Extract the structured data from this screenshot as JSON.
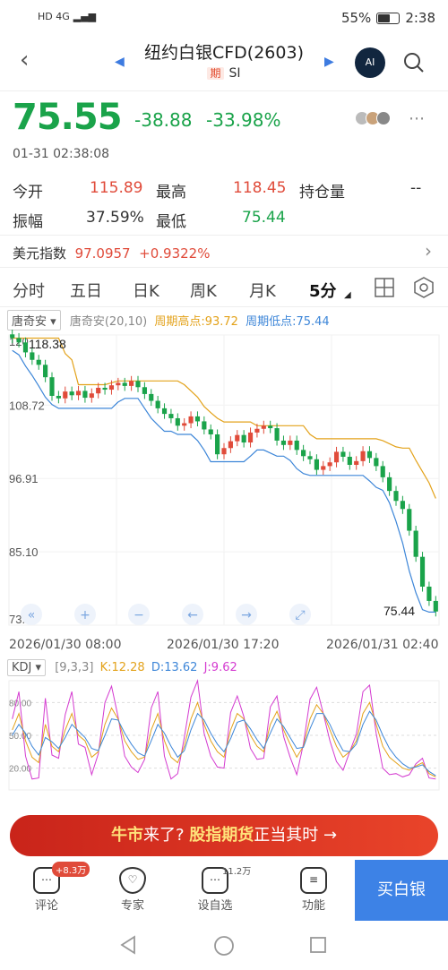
{
  "status": {
    "left": "HD 4G",
    "battery": "55%",
    "time": "2:38"
  },
  "header": {
    "title": "纽约白银CFD(2603)",
    "tag": "期",
    "code": "SI",
    "ai": "AI"
  },
  "quote": {
    "price": "75.55",
    "change": "-38.88",
    "pct": "-33.98%",
    "time": "01-31 02:38:08",
    "open_l": "今开",
    "open": "115.89",
    "high_l": "最高",
    "high": "118.45",
    "oi_l": "持仓量",
    "oi": "--",
    "amp_l": "振幅",
    "amp": "37.59%",
    "low_l": "最低",
    "low": "75.44",
    "usd_l": "美元指数",
    "usd": "97.0957",
    "usd_chg": "+0.9322%"
  },
  "tabs": [
    "分时",
    "五日",
    "日K",
    "周K",
    "月K",
    "5分"
  ],
  "indicator": {
    "name": "唐奇安",
    "params": "唐奇安(20,10)",
    "high": "周期高点:93.72",
    "low": "周期低点:75.44"
  },
  "yaxis": [
    "120",
    "108.72",
    "96.91",
    "85.10",
    "73.30"
  ],
  "hi_label": "118.38",
  "lo_label": "75.44",
  "xaxis": [
    "2026/01/30 08:00",
    "2026/01/30 17:20",
    "2026/01/31 02:40"
  ],
  "kdj": {
    "name": "KDJ",
    "params": "[9,3,3]",
    "k": "K:12.28",
    "d": "D:13.62",
    "j": "J:9.62",
    "levels": [
      "80.00",
      "50.00",
      "20.00"
    ]
  },
  "banner": {
    "a": "牛市",
    "b": "来了? ",
    "c": "股指期货",
    "d": "正当其时 →"
  },
  "bottom": {
    "comment": "评论",
    "comment_badge": "+8.3万",
    "expert": "专家",
    "watch": "设自选",
    "watch_count": "11.2万",
    "func": "功能",
    "buy": "买白银"
  },
  "colors": {
    "up": "#e04b3a",
    "down": "#1aa34a",
    "upper": "#e3a21a",
    "lower": "#3d86d8",
    "buy": "#3d82e6"
  },
  "chart_data": {
    "type": "candlestick",
    "ylim": [
      73.3,
      120
    ],
    "yticks": [
      120,
      108.72,
      96.91,
      85.1,
      73.3
    ],
    "close": [
      119.5,
      118.8,
      117.2,
      116.0,
      115.2,
      113.2,
      110.2,
      109.8,
      110.9,
      110.3,
      111.0,
      109.9,
      110.6,
      111.5,
      111.2,
      111.9,
      112.3,
      111.8,
      112.6,
      111.6,
      110.5,
      109.4,
      108.2,
      107.3,
      106.6,
      105.4,
      105.8,
      106.9,
      106.1,
      104.8,
      104.0,
      100.8,
      101.8,
      102.9,
      103.9,
      102.7,
      104.3,
      104.9,
      105.4,
      105.0,
      103.0,
      102.3,
      103.0,
      101.5,
      100.5,
      100.0,
      98.3,
      98.9,
      99.5,
      101.2,
      100.4,
      99.1,
      99.7,
      101.3,
      100.2,
      98.9,
      97.1,
      94.9,
      93.3,
      92.0,
      88.5,
      84.3,
      79.5,
      77.2,
      75.5
    ],
    "upper": [
      119.5,
      119.5,
      119.5,
      119.5,
      119.5,
      119.5,
      119.5,
      119.5,
      117.0,
      116.0,
      112.0,
      112.0,
      112.0,
      112.0,
      112.0,
      112.3,
      112.6,
      112.6,
      112.6,
      112.6,
      112.6,
      112.6,
      112.6,
      112.6,
      112.6,
      112.6,
      112.0,
      111.0,
      110.0,
      108.5,
      107.5,
      106.6,
      106.0,
      106.0,
      106.0,
      106.0,
      106.0,
      105.4,
      105.4,
      105.4,
      105.4,
      105.4,
      105.4,
      105.4,
      105.4,
      104.0,
      103.3,
      103.3,
      103.3,
      103.3,
      103.3,
      103.3,
      103.3,
      103.3,
      103.3,
      103.3,
      103.0,
      102.5,
      102.0,
      101.8,
      101.8,
      99.8,
      98.0,
      96.2,
      93.7
    ],
    "lower": [
      117.5,
      116.8,
      115.0,
      113.5,
      111.8,
      110.0,
      108.8,
      108.2,
      108.2,
      108.2,
      108.2,
      108.2,
      108.2,
      108.2,
      108.2,
      108.2,
      109.2,
      109.8,
      109.8,
      109.8,
      108.2,
      106.6,
      105.5,
      104.5,
      104.5,
      104.0,
      104.0,
      104.0,
      103.0,
      101.5,
      99.6,
      99.6,
      99.6,
      99.6,
      99.6,
      99.6,
      100.5,
      101.5,
      101.5,
      101.0,
      100.5,
      100.5,
      99.8,
      98.5,
      97.7,
      97.4,
      97.4,
      97.4,
      97.4,
      97.4,
      97.4,
      97.4,
      97.4,
      97.4,
      96.5,
      95.5,
      95.0,
      93.0,
      90.0,
      86.5,
      82.0,
      78.5,
      75.8,
      75.4,
      75.4
    ],
    "kdj_k": [
      55,
      70,
      45,
      30,
      25,
      60,
      40,
      35,
      55,
      70,
      50,
      45,
      30,
      35,
      60,
      75,
      65,
      45,
      35,
      28,
      30,
      55,
      70,
      45,
      30,
      25,
      40,
      65,
      80,
      60,
      45,
      35,
      30,
      55,
      70,
      65,
      50,
      40,
      35,
      60,
      72,
      55,
      42,
      30,
      40,
      65,
      78,
      70,
      55,
      40,
      30,
      35,
      45,
      70,
      80,
      60,
      40,
      30,
      25,
      20,
      18,
      22,
      25,
      15,
      12
    ],
    "kdj_d": [
      50,
      60,
      52,
      40,
      32,
      48,
      44,
      38,
      48,
      60,
      54,
      48,
      38,
      36,
      50,
      65,
      64,
      52,
      42,
      34,
      31,
      45,
      60,
      52,
      40,
      30,
      36,
      55,
      70,
      64,
      52,
      42,
      35,
      47,
      62,
      64,
      56,
      46,
      38,
      52,
      65,
      58,
      48,
      38,
      39,
      56,
      70,
      70,
      60,
      47,
      36,
      35,
      42,
      60,
      72,
      64,
      50,
      38,
      30,
      24,
      20,
      21,
      23,
      17,
      13
    ],
    "kdj_j": [
      65,
      90,
      31,
      10,
      11,
      84,
      32,
      29,
      69,
      90,
      42,
      39,
      14,
      33,
      80,
      95,
      67,
      31,
      21,
      16,
      28,
      75,
      90,
      31,
      10,
      15,
      48,
      85,
      100,
      52,
      31,
      21,
      20,
      71,
      86,
      67,
      38,
      28,
      29,
      76,
      86,
      49,
      30,
      14,
      42,
      83,
      94,
      70,
      45,
      26,
      18,
      35,
      51,
      90,
      96,
      52,
      20,
      14,
      15,
      12,
      14,
      24,
      29,
      11,
      10
    ]
  }
}
